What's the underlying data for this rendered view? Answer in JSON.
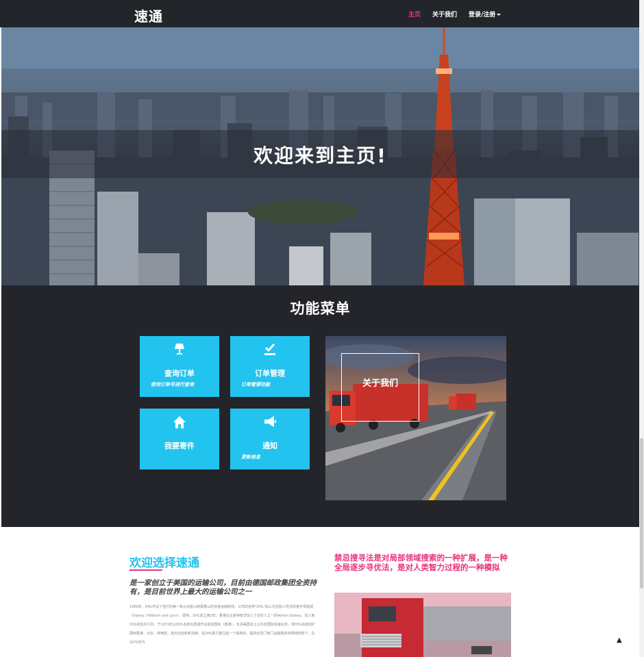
{
  "navbar": {
    "brand": "速通",
    "items": [
      {
        "label": "主页",
        "active": true
      },
      {
        "label": "关于我们",
        "active": false
      },
      {
        "label": "登录/注册",
        "active": false
      }
    ]
  },
  "hero": {
    "title": "欢迎来到主页!"
  },
  "menu": {
    "title": "功能菜单",
    "tiles": [
      {
        "icon": "lamp-icon",
        "label": "查询订单",
        "sub": "使用订单号进行查询"
      },
      {
        "icon": "checklist-icon",
        "label": "订单管理",
        "sub": "订单管理功能"
      },
      {
        "icon": "home-icon",
        "label": "我要寄件",
        "sub": ""
      },
      {
        "icon": "megaphone-icon",
        "label": "通知",
        "sub": "更新信息"
      }
    ],
    "about_label": "关于我们"
  },
  "welcome": {
    "title": "欢迎选择速通",
    "subtitle": "是一家创立于美国的运输公司，目前由德国邮政集团全资持有，是目前世界上最大的运输公司之一",
    "body": "1969年，DHL开设了他们的第一条从旧金山到檀香山的快递运输航线，公司的名称\"DHL\"由三位创始人姓氏的首字母组成（Dalsey, Hillblom and Lynn），很快，DHL成立第3年，香港企业家钟普洋加入了创办人之一的Adrian Dalsey，加入到DHL的创办行列，于1972年以DHL名称在香港开设首家国际（香港），负责美国本土以外的国际快递业务，将DHL的航线扩展到香港、日本、菲律宾、澳大利亚和新加坡。在DHL致力建立起一个崭新的、提供全球门到门运输服务的网络构想下，在1970年代",
    "side_title": "禁忌搜寻法是对局部领域搜索的一种扩展，是一种全局逐步寻优法，是对人类智力过程的一种模拟"
  },
  "colors": {
    "accent_cyan": "#23c3ef",
    "accent_pink": "#e8337c",
    "navbar_bg": "#22252a",
    "section_bg": "#23252b"
  }
}
